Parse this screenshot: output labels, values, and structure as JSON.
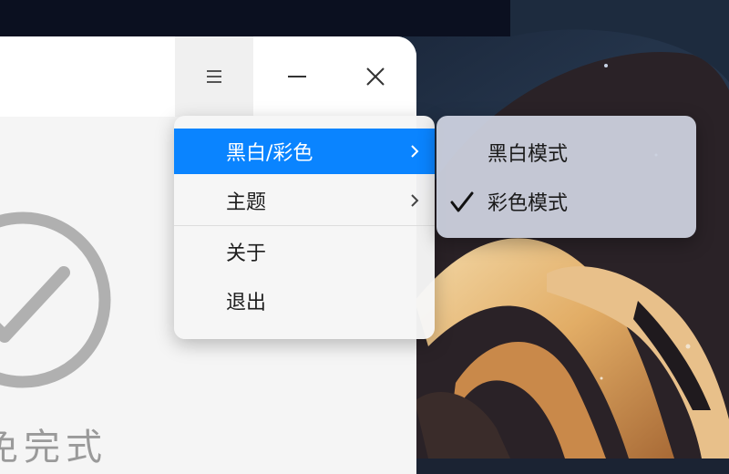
{
  "app": {
    "title_menu_icon": "hamburger-icon",
    "minimize_icon": "minimize-icon",
    "close_icon": "close-icon",
    "status_text": "免完式"
  },
  "menu": {
    "items": [
      {
        "label": "黑白/彩色",
        "has_submenu": true,
        "highlighted": true
      },
      {
        "label": "主题",
        "has_submenu": true,
        "highlighted": false
      },
      {
        "label": "关于",
        "has_submenu": false,
        "highlighted": false
      },
      {
        "label": "退出",
        "has_submenu": false,
        "highlighted": false
      }
    ]
  },
  "submenu": {
    "items": [
      {
        "label": "黑白模式",
        "checked": false
      },
      {
        "label": "彩色模式",
        "checked": true
      }
    ]
  },
  "colors": {
    "highlight": "#0a84ff",
    "check_icon": "checkmark-icon",
    "circle_check_icon": "circle-check-icon"
  }
}
